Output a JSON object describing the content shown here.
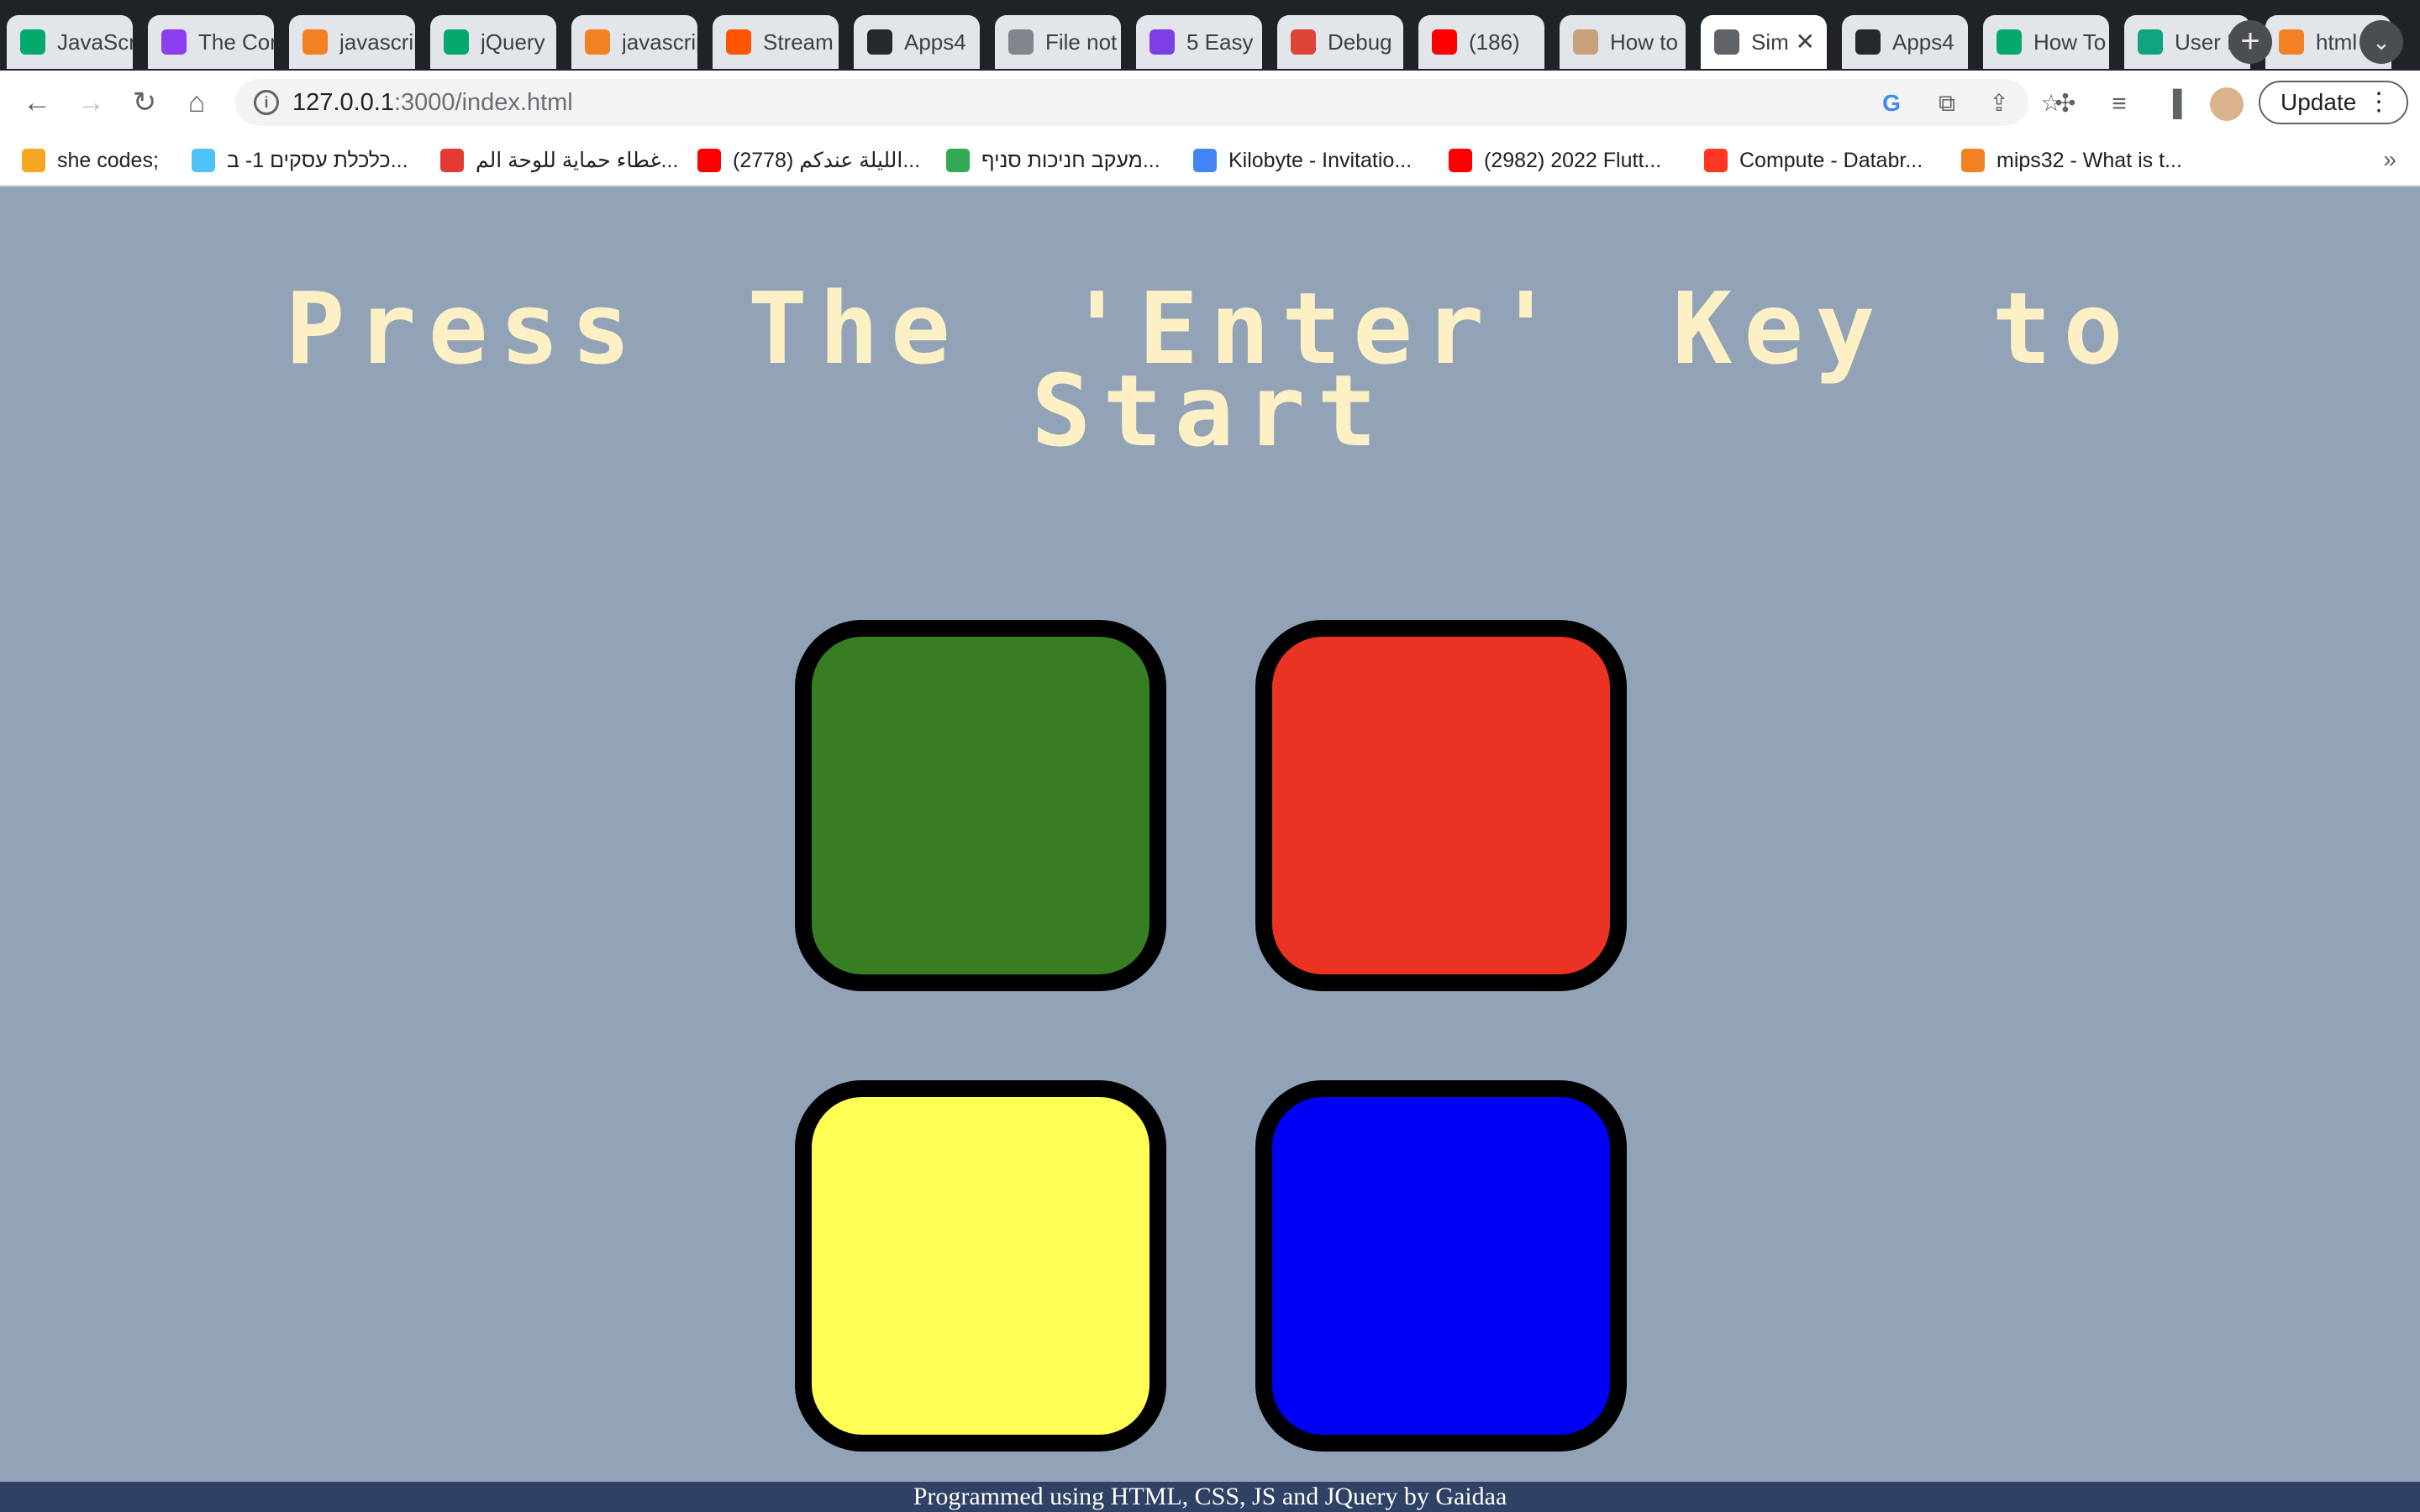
{
  "browser": {
    "tabs": [
      {
        "title": "JavaScript",
        "icon": "w3schools-icon",
        "color": "#04aa6d"
      },
      {
        "title": "The Complete",
        "icon": "udemy-icon",
        "color": "#8c3df0"
      },
      {
        "title": "javascript",
        "icon": "stackoverflow-icon",
        "color": "#f48024"
      },
      {
        "title": "jQuery",
        "icon": "w3schools-icon",
        "color": "#04aa6d"
      },
      {
        "title": "javascript",
        "icon": "stackoverflow-icon",
        "color": "#f48024"
      },
      {
        "title": "Stream",
        "icon": "soundcloud-icon",
        "color": "#ff5500"
      },
      {
        "title": "Apps4",
        "icon": "github-icon",
        "color": "#24292e"
      },
      {
        "title": "File not",
        "icon": "globe-icon",
        "color": "#80868b"
      },
      {
        "title": "5 Easy",
        "icon": "k-icon",
        "color": "#7b3fe4"
      },
      {
        "title": "Debug",
        "icon": "chrome-icon",
        "color": "#db4437"
      },
      {
        "title": "(186)",
        "icon": "youtube-icon",
        "color": "#ff0000"
      },
      {
        "title": "How to",
        "icon": "avatar-icon",
        "color": "#c8a27a"
      },
      {
        "title": "Sim",
        "icon": "globe-icon",
        "color": "#5f6368",
        "active": true
      },
      {
        "title": "Apps4",
        "icon": "github-icon",
        "color": "#24292e"
      },
      {
        "title": "How To",
        "icon": "w3schools-icon",
        "color": "#04aa6d"
      },
      {
        "title": "User R",
        "icon": "openai-icon",
        "color": "#10a37f"
      },
      {
        "title": "html -",
        "icon": "stackoverflow-icon",
        "color": "#f48024"
      }
    ],
    "close_glyph": "✕",
    "new_tab_glyph": "+",
    "url_host": "127.0.0.1",
    "url_rest": ":3000/index.html",
    "update_label": "Update",
    "bookmarks": [
      {
        "label": "she codes;",
        "color": "#f5a623"
      },
      {
        "label": "כלכלת עסקים 1- ב...",
        "color": "#4fc3f7"
      },
      {
        "label": "غطاء حماية للوحة الم...",
        "color": "#e53935"
      },
      {
        "label": "(2778) الليلة عندكم...",
        "color": "#ff0000"
      },
      {
        "label": "מעקב חניכות סניף...",
        "color": "#34a853"
      },
      {
        "label": "Kilobyte - Invitatio...",
        "color": "#4285f4"
      },
      {
        "label": "(2982) 2022 Flutt...",
        "color": "#ff0000"
      },
      {
        "label": "Compute - Databr...",
        "color": "#ff3621"
      },
      {
        "label": "mips32 - What is t...",
        "color": "#f48024"
      }
    ],
    "more_bookmarks": "»"
  },
  "game": {
    "title": "Press The 'Enter' Key to Start",
    "buttons": [
      {
        "name": "green",
        "color": "#377e22"
      },
      {
        "name": "red",
        "color": "#ea3323"
      },
      {
        "name": "yellow",
        "color": "#fffe55"
      },
      {
        "name": "blue",
        "color": "#0000f5"
      }
    ],
    "footer": "Programmed using HTML, CSS, JS and JQuery by Gaidaa",
    "background": "#92a3b8"
  }
}
